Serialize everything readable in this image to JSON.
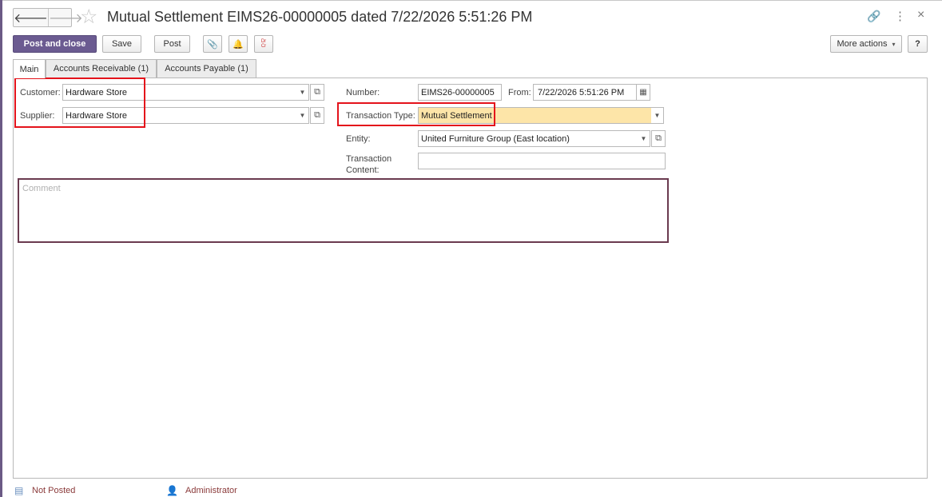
{
  "header": {
    "back_glyph": "🡐",
    "forward_glyph": "🡒",
    "star_glyph": "☆",
    "title": "Mutual Settlement EIMS26-00000005 dated 7/22/2026 5:51:26 PM",
    "link_glyph": "🔗",
    "more_glyph": "⋮",
    "close_glyph": "×"
  },
  "toolbar": {
    "post_and_close_label": "Post and close",
    "save_label": "Save",
    "post_label": "Post",
    "attach_glyph": "📎",
    "bell_glyph": "🔔",
    "dtct_glyph": "Dr Cr",
    "more_actions_label": "More actions",
    "help_label": "?"
  },
  "tabs": [
    {
      "label": "Main"
    },
    {
      "label": "Accounts Receivable (1)"
    },
    {
      "label": "Accounts Payable (1)"
    }
  ],
  "form": {
    "customer_label": "Customer:",
    "customer_value": "Hardware Store",
    "supplier_label": "Supplier:",
    "supplier_value": "Hardware Store",
    "number_label": "Number:",
    "number_value": "EIMS26-00000005",
    "from_label": "From:",
    "from_value": "7/22/2026  5:51:26 PM",
    "transaction_type_label": "Transaction Type:",
    "transaction_type_value": "Mutual Settlement",
    "entity_label": "Entity:",
    "entity_value": "United Furniture Group (East location)",
    "transaction_content_label": "Transaction Content:",
    "transaction_content_value": "",
    "comment_placeholder": "Comment"
  },
  "status": {
    "posted_status": "Not Posted",
    "user": "Administrator"
  },
  "colors": {
    "primary_button": "#6b5b91",
    "highlight_field": "#fde5a8",
    "annotation_red": "#e4131b"
  }
}
